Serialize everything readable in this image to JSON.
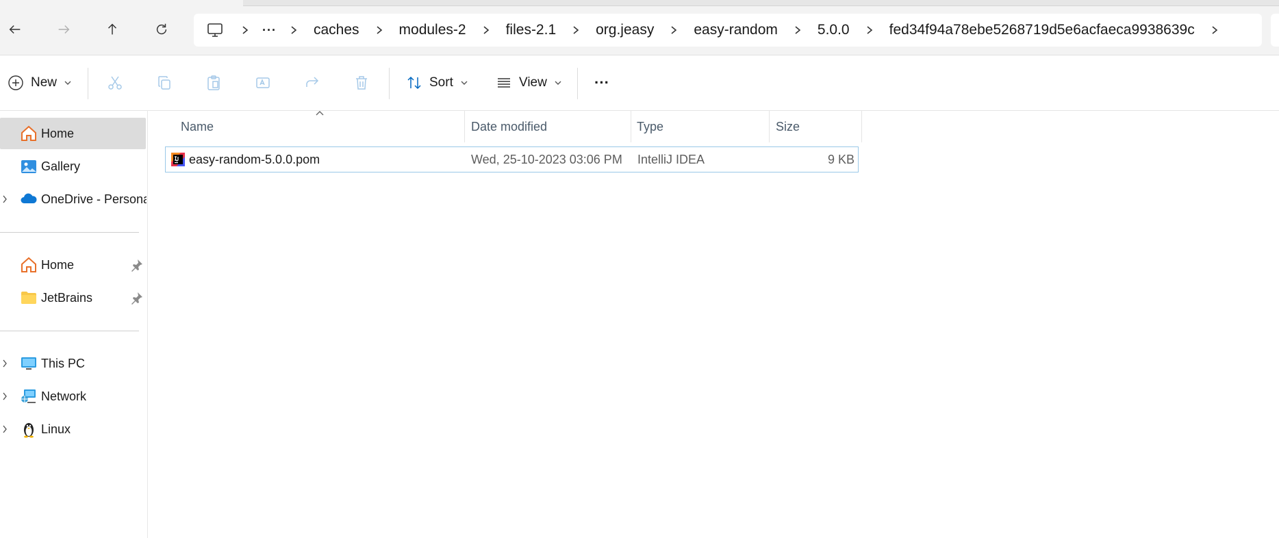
{
  "address_bar": {
    "overflow_label": "···",
    "breadcrumbs": [
      "caches",
      "modules-2",
      "files-2.1",
      "org.jeasy",
      "easy-random",
      "5.0.0",
      "fed34f94a78ebe5268719d5e6acfaeca9938639c"
    ]
  },
  "nav": {
    "back_icon": "arrow-left-icon",
    "forward_icon": "arrow-right-icon",
    "up_icon": "arrow-up-icon",
    "refresh_icon": "refresh-icon"
  },
  "toolbar": {
    "new_label": "New",
    "sort_label": "Sort",
    "view_label": "View",
    "more_label": "···"
  },
  "sidebar": {
    "items": [
      {
        "label": "Home",
        "icon": "home-icon",
        "selected": true
      },
      {
        "label": "Gallery",
        "icon": "gallery-icon"
      },
      {
        "label": "OneDrive - Persona",
        "icon": "onedrive-cloud-icon",
        "expandable": true
      },
      {
        "label": "Home",
        "icon": "home-icon",
        "pinned": true
      },
      {
        "label": "JetBrains",
        "icon": "folder-icon",
        "pinned": true
      },
      {
        "label": "This PC",
        "icon": "monitor-icon",
        "expandable": true
      },
      {
        "label": "Network",
        "icon": "network-icon",
        "expandable": true
      },
      {
        "label": "Linux",
        "icon": "linux-penguin-icon",
        "expandable": true
      }
    ]
  },
  "file_list": {
    "columns": {
      "name": "Name",
      "date": "Date modified",
      "type": "Type",
      "size": "Size"
    },
    "rows": [
      {
        "name": "easy-random-5.0.0.pom",
        "date": "Wed, 25-10-2023 03:06 PM",
        "type": "IntelliJ IDEA",
        "size": "9 KB",
        "icon": "intellij-idea-icon"
      }
    ]
  },
  "colors": {
    "accent": "#0067c0",
    "selection_border": "#99c8e8",
    "folder_yellow": "#f8c84a",
    "onedrive_blue": "#0f78d4"
  }
}
